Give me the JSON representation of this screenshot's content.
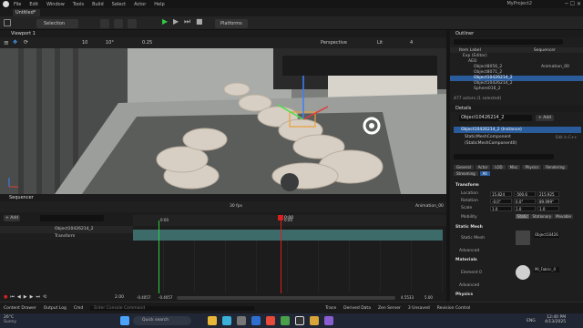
{
  "menu": {
    "items": [
      "File",
      "Edit",
      "Window",
      "Tools",
      "Build",
      "Select",
      "Actor",
      "Help"
    ],
    "project": "MyProject2"
  },
  "tab": {
    "label": "Untitled*"
  },
  "toolbar": {
    "mode": "Selection Mode",
    "platforms": "Platforms"
  },
  "viewport": {
    "tab": "Viewport 1",
    "perspective": "Perspective",
    "lit": "Lit",
    "snap1": "10",
    "snap2": "10°",
    "snap3": "0.25",
    "speed": "4"
  },
  "outliner": {
    "title": "Outliner",
    "col_label": "Item Label",
    "col_type": "Type",
    "sequencer_label": "Sequencer",
    "items": [
      {
        "label": "Exp (Editor)",
        "type": "World"
      },
      {
        "label": "AEO",
        "type": ""
      },
      {
        "label": "Object8056_2",
        "type": "Animation_00"
      },
      {
        "label": "Object8071_2",
        "type": ""
      },
      {
        "label": "Object10426214_2",
        "type": ""
      },
      {
        "label": "Object10426214_2",
        "type": ""
      },
      {
        "label": "Sphere016_2",
        "type": ""
      }
    ],
    "footer": "477 actors (1 selected)"
  },
  "details": {
    "title": "Details",
    "object": "Object10426214_2",
    "add": "+ Add",
    "instance": "Object10426214_2 (Instance)",
    "component": "StaticMeshComponent (StaticMeshComponent0)",
    "edit_label": "Edit in C++",
    "search_placeholder": "Search",
    "tabs": [
      "General",
      "Actor",
      "LOD",
      "Misc",
      "Physics",
      "Rendering",
      "Streaming",
      "All"
    ],
    "sections": {
      "transform": "Transform",
      "static_mesh": "Static Mesh",
      "advanced": "Advanced",
      "materials": "Materials",
      "advanced2": "Advanced",
      "physics": "Physics"
    },
    "location": {
      "label": "Location",
      "x": "15.824",
      "y": "-500.6",
      "z": "215.925"
    },
    "rotation": {
      "label": "Rotation",
      "x": "-0.0°",
      "y": "0.0°",
      "z": "89.999°"
    },
    "scale": {
      "label": "Scale",
      "x": "1.0",
      "y": "1.0",
      "z": "1.0"
    },
    "mobility": {
      "label": "Mobility",
      "options": [
        "Static",
        "Stationary",
        "Movable"
      ]
    },
    "static_mesh": {
      "label": "Static Mesh",
      "value": "Object10426"
    },
    "material": {
      "label": "Element 0",
      "value": "MI_Fabric_0"
    }
  },
  "sequencer": {
    "tab": "Sequencer",
    "add": "+ Add",
    "fps": "30 fps",
    "time": "0:00",
    "anim_name": "Animation_00",
    "track_object": "Object10426214_2",
    "track_transform": "Transform",
    "ruler": [
      "0:00",
      "0:00"
    ],
    "start": "-0.4057",
    "end": "-0.4057",
    "range_end_a": "4.5533",
    "range_end_b": "5.00",
    "playhead_value": "2.00"
  },
  "status": {
    "content_drawer": "Content Drawer",
    "output_log": "Output Log",
    "cmd": "Cmd",
    "cmd_placeholder": "Enter Console Command",
    "trace": "Trace",
    "derived_data": "Derived Data",
    "zen": "Zen Server",
    "unsaved": "3 Unsaved",
    "revision": "Revision Control"
  },
  "taskbar": {
    "weather_temp": "26°C",
    "weather_desc": "Sunny",
    "search_placeholder": "Quick search",
    "lang": "ENG",
    "time": "12:40 PM",
    "date": "4/13/2025"
  }
}
